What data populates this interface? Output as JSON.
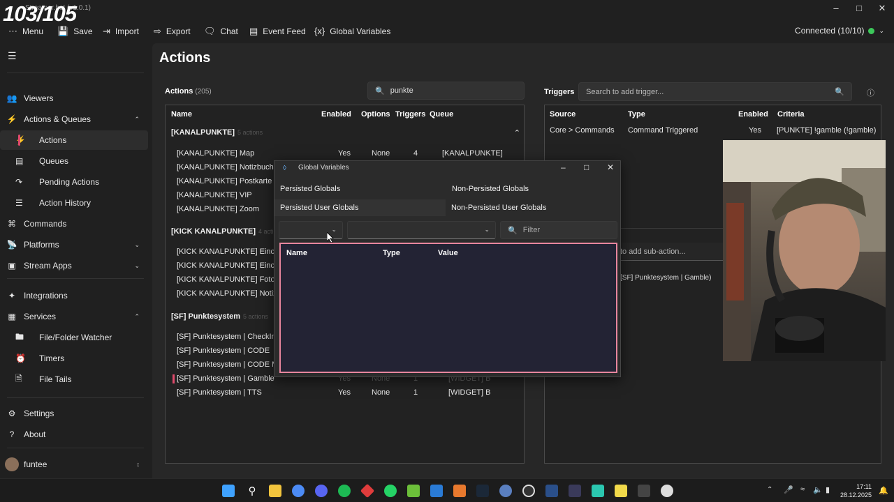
{
  "window": {
    "title": "Streamer.bot (v1.0.1)",
    "overlay_counter": "103/105"
  },
  "toolbar": {
    "menu": "Menu",
    "save": "Save",
    "import": "Import",
    "export": "Export",
    "chat": "Chat",
    "event_feed": "Event Feed",
    "global_variables": "Global Variables",
    "status": "Connected (10/10)"
  },
  "sidebar": {
    "viewers": "Viewers",
    "actions_queues": "Actions & Queues",
    "actions": "Actions",
    "queues": "Queues",
    "pending_actions": "Pending Actions",
    "action_history": "Action History",
    "commands": "Commands",
    "platforms": "Platforms",
    "stream_apps": "Stream Apps",
    "integrations": "Integrations",
    "services": "Services",
    "file_folder_watcher": "File/Folder Watcher",
    "timers": "Timers",
    "file_tails": "File Tails",
    "settings": "Settings",
    "about": "About",
    "user": "funtee"
  },
  "main": {
    "title": "Actions",
    "actions_label": "Actions",
    "actions_count": "(205)",
    "search_value": "punkte",
    "columns": {
      "name": "Name",
      "enabled": "Enabled",
      "options": "Options",
      "triggers": "Triggers",
      "queue": "Queue"
    },
    "groups": [
      {
        "name": "[KANALPUNKTE]",
        "count": "5 actions"
      },
      {
        "name": "[KICK KANALPUNKTE]",
        "count": "4 actions"
      },
      {
        "name": "[SF] Punktesystem",
        "count": "5 actions"
      }
    ],
    "rows": [
      {
        "name": "[KANALPUNKTE] Map",
        "enabled": "Yes",
        "options": "None",
        "triggers": "4",
        "queue": "[KANALPUNKTE]"
      },
      {
        "name": "[KANALPUNKTE] Notizbuch"
      },
      {
        "name": "[KANALPUNKTE] Postkarte"
      },
      {
        "name": "[KANALPUNKTE] VIP"
      },
      {
        "name": "[KANALPUNKTE] Zoom"
      },
      {
        "name": "[KICK KANALPUNKTE] Einche"
      },
      {
        "name": "[KICK KANALPUNKTE] Einche"
      },
      {
        "name": "[KICK KANALPUNKTE] FotoRe"
      },
      {
        "name": "[KICK KANALPUNKTE] Notizbu"
      },
      {
        "name": "[SF] Punktesystem | CheckIn"
      },
      {
        "name": "[SF] Punktesystem | CODE"
      },
      {
        "name": "[SF] Punktesystem | CODE MO"
      },
      {
        "name": "[SF] Punktesystem | Gamble",
        "enabled": "Yes",
        "options": "None",
        "triggers": "1",
        "queue": "[WIDGET] B"
      },
      {
        "name": "[SF] Punktesystem | TTS",
        "enabled": "Yes",
        "options": "None",
        "triggers": "1",
        "queue": "[WIDGET] B"
      }
    ],
    "triggers": {
      "label": "Triggers",
      "search_placeholder": "Search to add trigger...",
      "columns": {
        "source": "Source",
        "type": "Type",
        "enabled": "Enabled",
        "criteria": "Criteria"
      },
      "row": {
        "source": "Core > Commands",
        "type": "Command Triggered",
        "enabled": "Yes",
        "criteria": "[PUNKTE] !gamble (!gamble)"
      }
    },
    "subactions": {
      "search_placeholder": "to add sub-action...",
      "row": "[SF] Punktesystem | Gamble)"
    }
  },
  "dialog": {
    "title": "Global Variables",
    "tabs": {
      "persisted_globals": "Persisted Globals",
      "non_persisted_globals": "Non-Persisted Globals",
      "persisted_user_globals": "Persisted User Globals",
      "non_persisted_user_globals": "Non-Persisted User Globals"
    },
    "filter_placeholder": "Filter",
    "columns": {
      "name": "Name",
      "type": "Type",
      "value": "Value"
    }
  },
  "taskbar": {
    "time": "17:11",
    "date": "28.12.2025"
  }
}
